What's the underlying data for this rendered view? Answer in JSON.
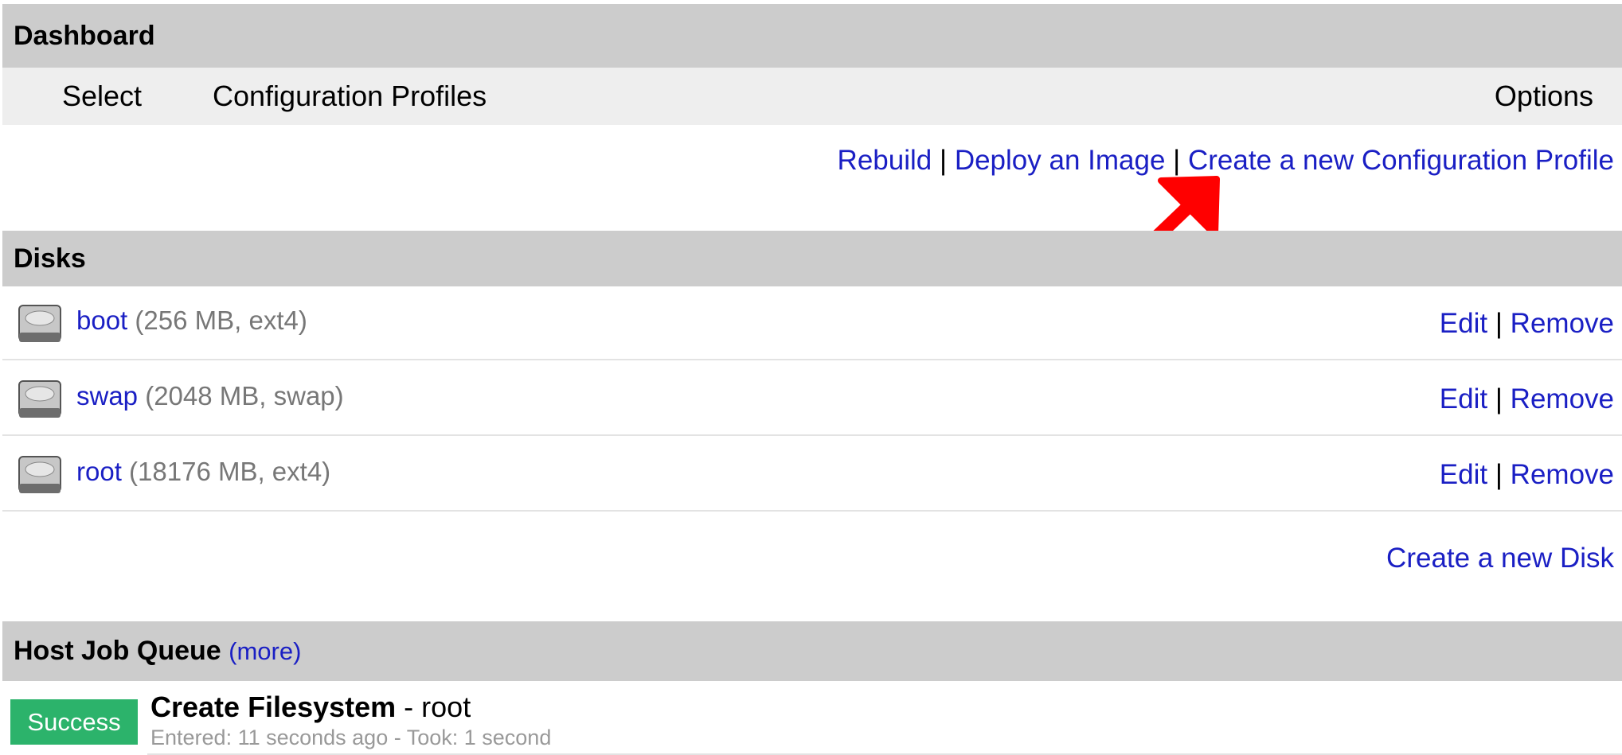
{
  "dashboard": {
    "title": "Dashboard"
  },
  "subnav": {
    "select_label": "Select",
    "profiles_label": "Configuration Profiles",
    "options_label": "Options"
  },
  "profile_actions": {
    "rebuild": "Rebuild",
    "deploy": "Deploy an Image",
    "create_profile": "Create a new Configuration Profile",
    "separator": "|"
  },
  "disks": {
    "title": "Disks",
    "items": [
      {
        "name": "boot",
        "detail": "(256 MB, ext4)",
        "edit": "Edit",
        "remove": "Remove"
      },
      {
        "name": "swap",
        "detail": "(2048 MB, swap)",
        "edit": "Edit",
        "remove": "Remove"
      },
      {
        "name": "root",
        "detail": "(18176 MB, ext4)",
        "edit": "Edit",
        "remove": "Remove"
      }
    ],
    "create_disk": "Create a new Disk"
  },
  "job_queue": {
    "title": "Host Job Queue",
    "more": "(more)",
    "jobs": [
      {
        "status": "Success",
        "title": "Create Filesystem",
        "dash": " - ",
        "target": "root",
        "meta": "Entered: 11 seconds ago - Took: 1 second"
      }
    ]
  },
  "colors": {
    "header_bg": "#cccccc",
    "subbar_bg": "#eeeeee",
    "link": "#1a1fc4",
    "success": "#2cb36b",
    "annotation_arrow": "#ff0000"
  }
}
